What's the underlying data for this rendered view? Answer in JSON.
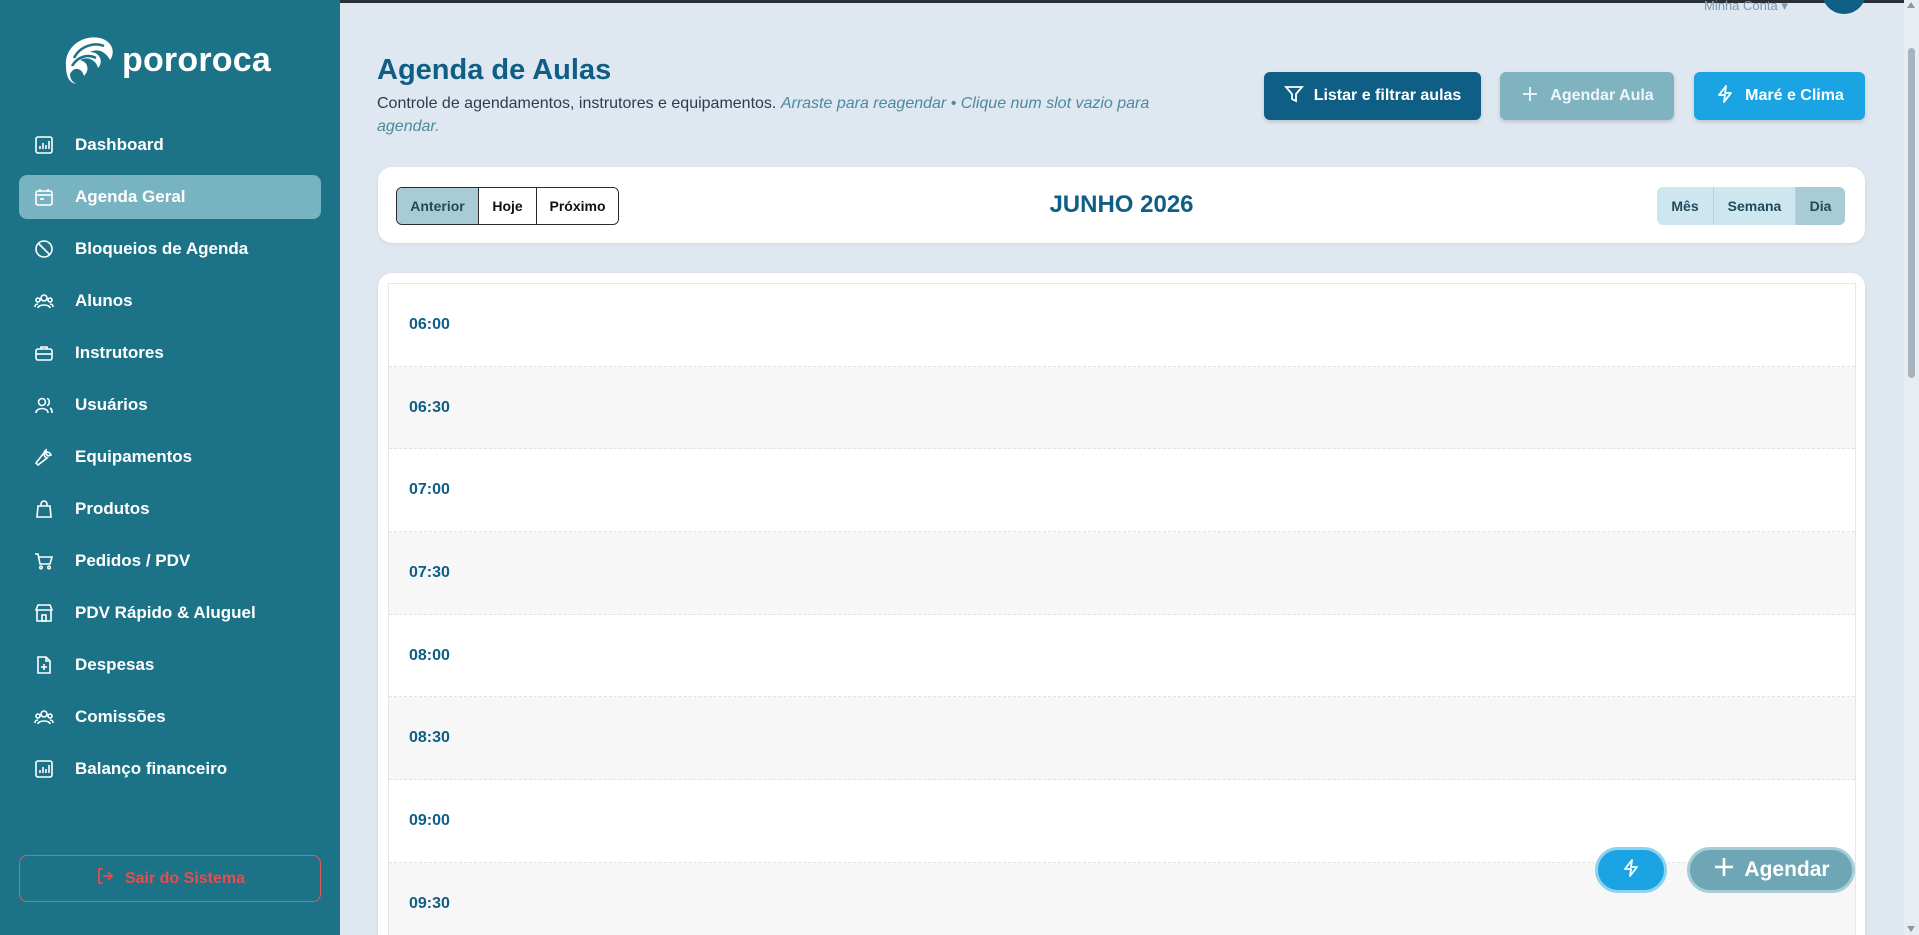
{
  "brand": {
    "name": "pororoca"
  },
  "account": {
    "label": "Minha Conta"
  },
  "sidebar": {
    "items": [
      {
        "label": "Dashboard",
        "icon": "chart-icon",
        "active": false
      },
      {
        "label": "Agenda Geral",
        "icon": "calendar-icon",
        "active": true
      },
      {
        "label": "Bloqueios de Agenda",
        "icon": "block-icon",
        "active": false
      },
      {
        "label": "Alunos",
        "icon": "users-icon",
        "active": false
      },
      {
        "label": "Instrutores",
        "icon": "briefcase-icon",
        "active": false
      },
      {
        "label": "Usuários",
        "icon": "user-group-icon",
        "active": false
      },
      {
        "label": "Equipamentos",
        "icon": "wrench-icon",
        "active": false
      },
      {
        "label": "Produtos",
        "icon": "bag-icon",
        "active": false
      },
      {
        "label": "Pedidos / PDV",
        "icon": "cart-icon",
        "active": false
      },
      {
        "label": "PDV Rápido & Aluguel",
        "icon": "store-icon",
        "active": false
      },
      {
        "label": "Despesas",
        "icon": "file-plus-icon",
        "active": false
      },
      {
        "label": "Comissões",
        "icon": "users-icon",
        "active": false
      },
      {
        "label": "Balanço financeiro",
        "icon": "chart-icon",
        "active": false
      }
    ],
    "logout_label": "Sair do Sistema"
  },
  "header": {
    "title": "Agenda de Aulas",
    "description": "Controle de agendamentos, instrutores e equipamentos.",
    "hint": "Arraste para reagendar • Clique num slot vazio para agendar.",
    "buttons": {
      "list_filter": "Listar e filtrar aulas",
      "schedule": "Agendar Aula",
      "tide_weather": "Maré e Clima"
    }
  },
  "calendar": {
    "nav": {
      "prev": "Anterior",
      "today": "Hoje",
      "next": "Próximo"
    },
    "title": "JUNHO 2026",
    "views": {
      "month": "Mês",
      "week": "Semana",
      "day": "Dia"
    },
    "active_view": "Dia",
    "slots": [
      "06:00",
      "06:30",
      "07:00",
      "07:30",
      "08:00",
      "08:30",
      "09:00",
      "09:30"
    ]
  },
  "fab": {
    "schedule_label": "Agendar"
  },
  "colors": {
    "sidebar": "#1c7387",
    "sidebar_active": "#78b3c2",
    "primary": "#0f5e86",
    "accent": "#1aa4e4",
    "danger": "#e84c4c",
    "background": "#dfe7f0"
  }
}
